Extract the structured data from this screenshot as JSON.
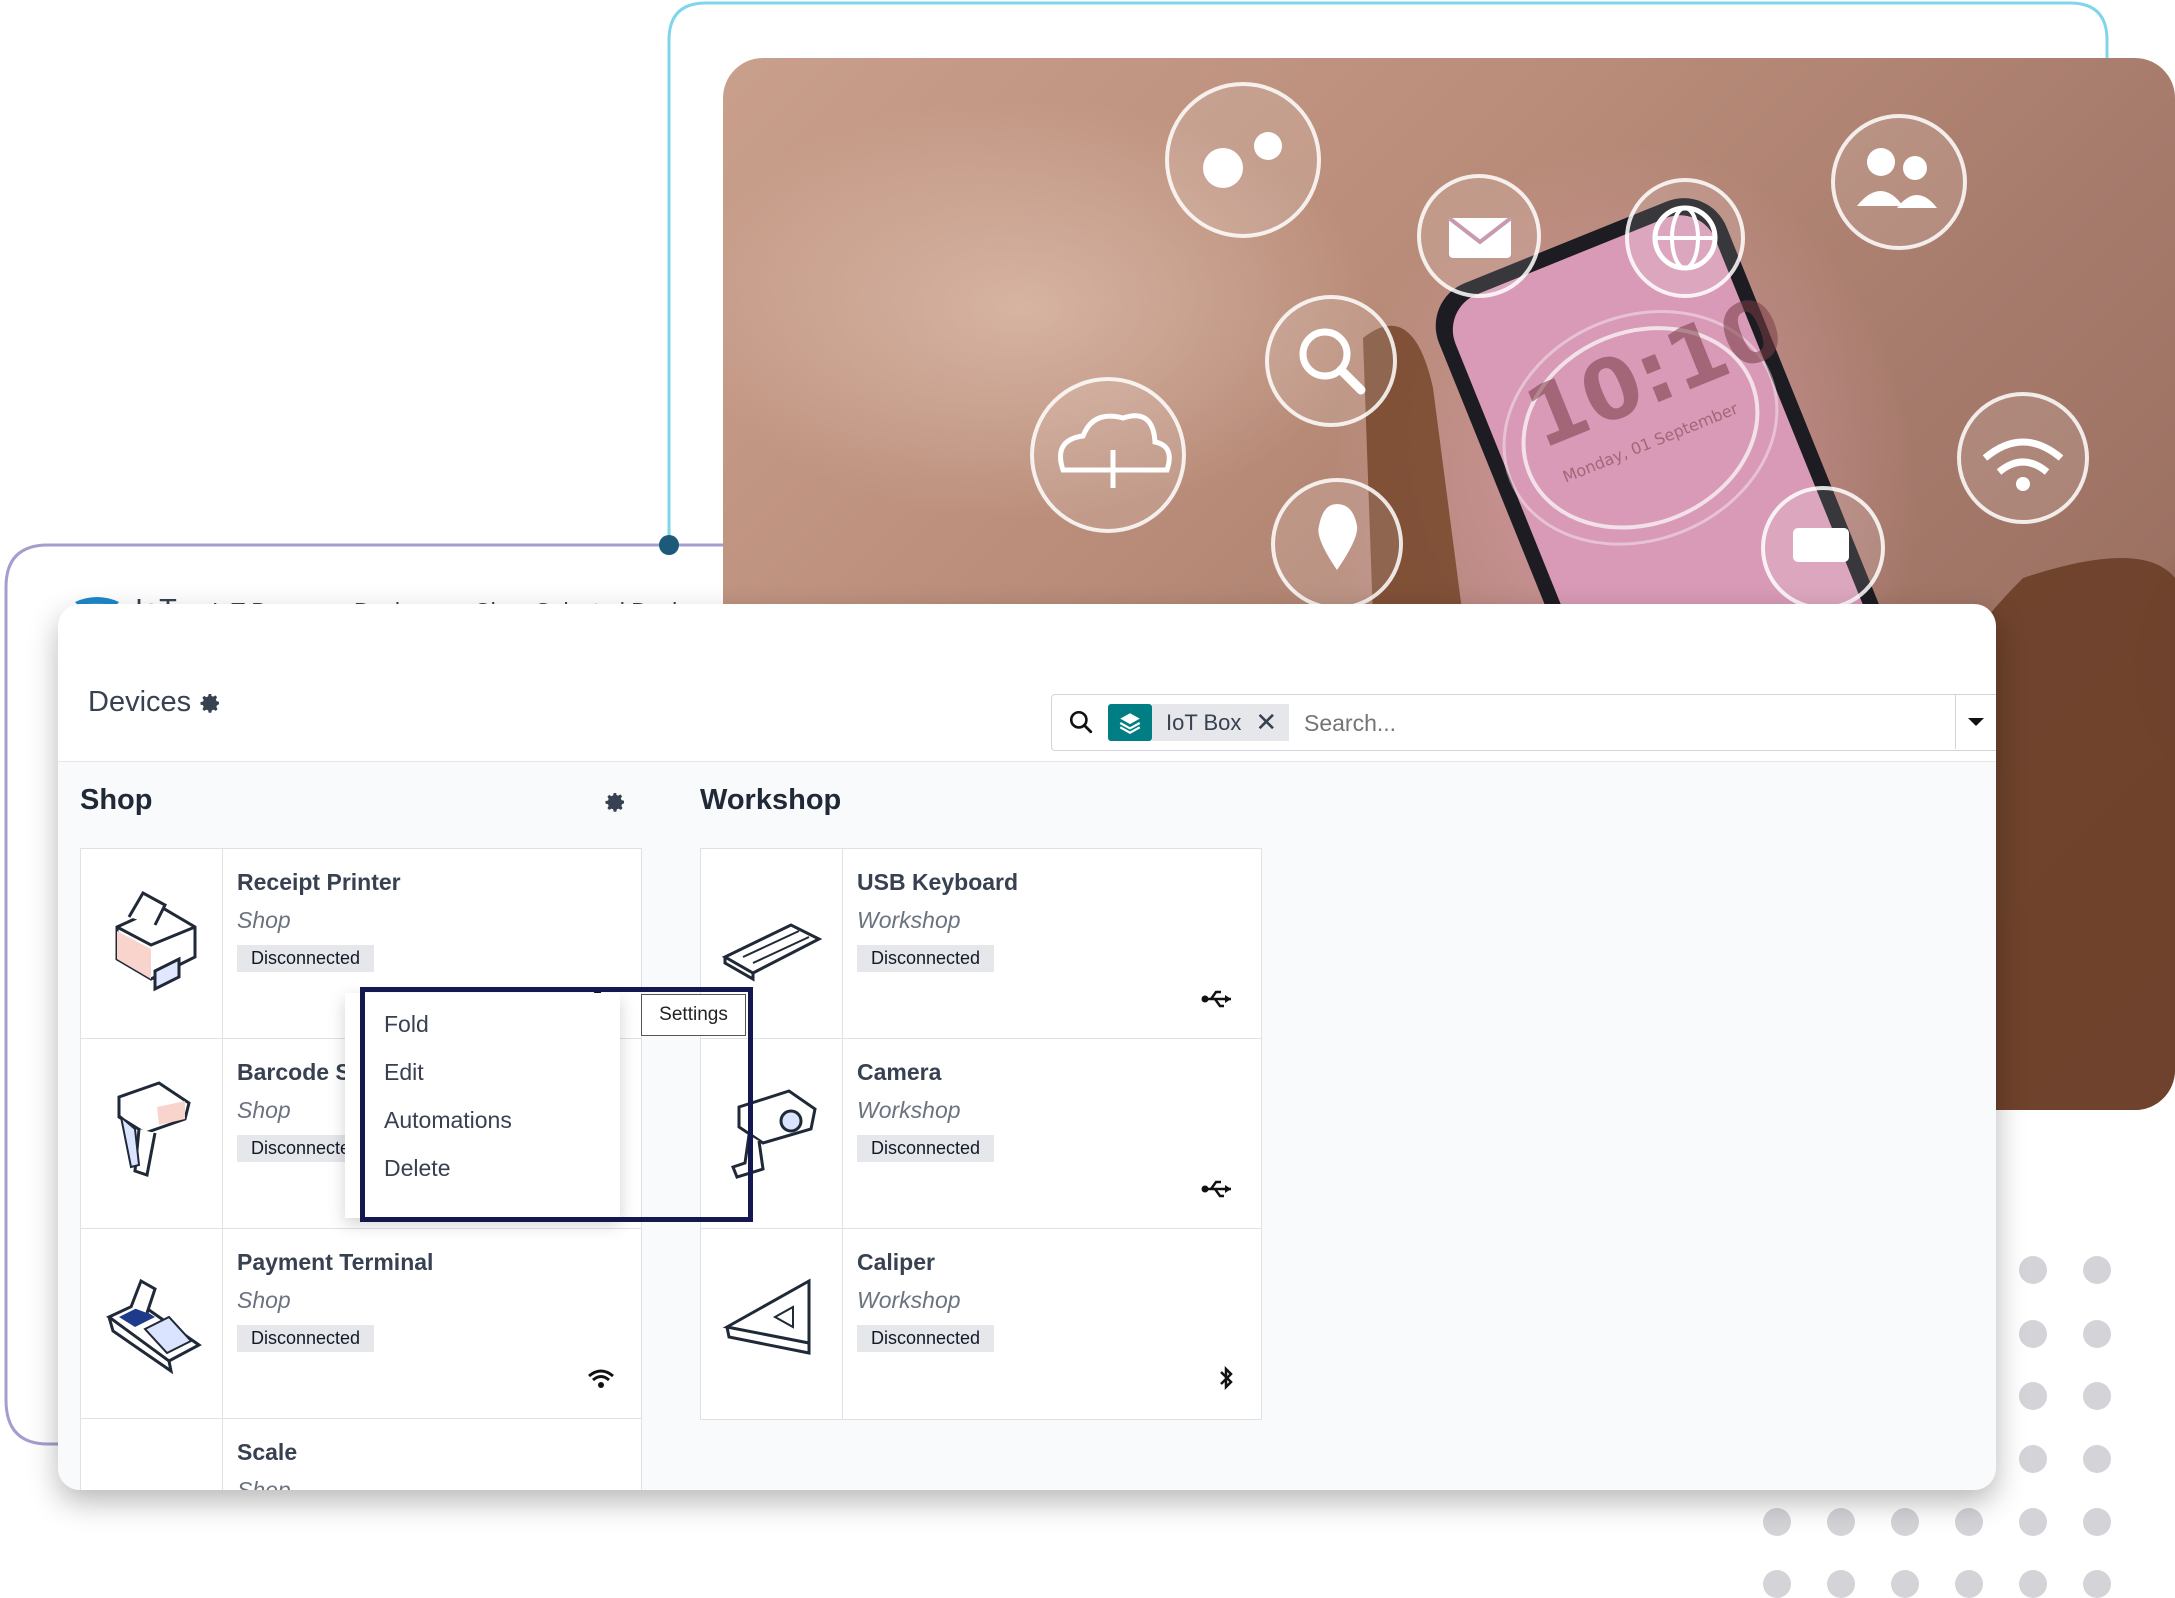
{
  "navbar": {
    "app_name": "IoT",
    "menu": [
      "IoT Boxes",
      "Devices",
      "Clear Selected Devices"
    ]
  },
  "control_panel": {
    "breadcrumb": "Devices",
    "search": {
      "facet_label": "IoT Box",
      "placeholder": "Search..."
    }
  },
  "groups": [
    {
      "title": "Shop",
      "cards": [
        {
          "name": "Receipt Printer",
          "location": "Shop",
          "status": "Disconnected",
          "connection": "usb-icon",
          "image": "printer-icon"
        },
        {
          "name": "Barcode Scanner",
          "location": "Shop",
          "status": "Disconnected",
          "connection": "usb-icon",
          "image": "barcode-scanner-icon"
        },
        {
          "name": "Payment Terminal",
          "location": "Shop",
          "status": "Disconnected",
          "connection": "wifi-icon",
          "image": "payment-terminal-icon"
        },
        {
          "name": "Scale",
          "location": "Shop",
          "status": "",
          "connection": "",
          "image": "scale-icon"
        }
      ]
    },
    {
      "title": "Workshop",
      "cards": [
        {
          "name": "USB Keyboard",
          "location": "Workshop",
          "status": "Disconnected",
          "connection": "usb-icon",
          "image": "keyboard-icon"
        },
        {
          "name": "Camera",
          "location": "Workshop",
          "status": "Disconnected",
          "connection": "usb-icon",
          "image": "camera-icon"
        },
        {
          "name": "Caliper",
          "location": "Workshop",
          "status": "Disconnected",
          "connection": "bluetooth-icon",
          "image": "caliper-icon"
        }
      ]
    }
  ],
  "settings_menu": {
    "tooltip": "Settings",
    "items": [
      "Fold",
      "Edit",
      "Automations",
      "Delete"
    ]
  },
  "photo": {
    "clock_time": "10:10",
    "clock_date": "Monday, 01 September"
  },
  "colors": {
    "highlight_border": "#141850",
    "accent_teal": "#017e84",
    "deco_line_blue": "#7fd6ea",
    "deco_line_purple": "#a49ecf",
    "deco_dot": "#1d5a7a"
  }
}
